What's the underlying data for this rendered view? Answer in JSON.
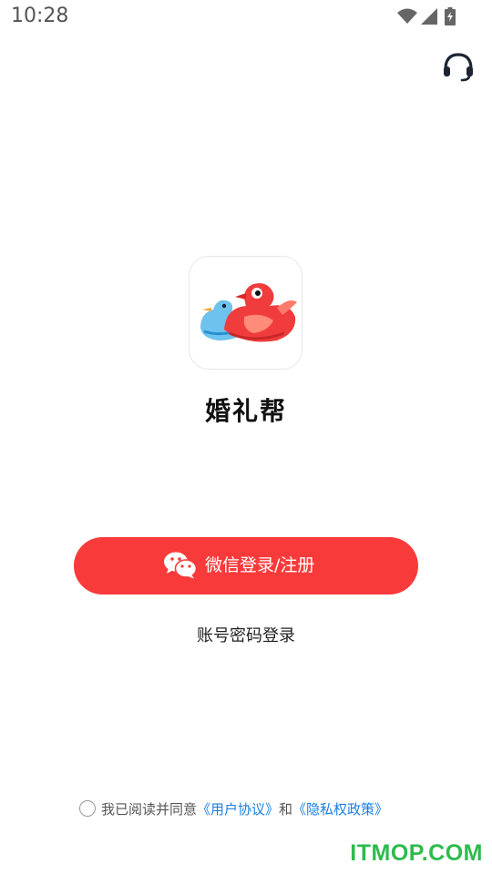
{
  "status_bar": {
    "time": "10:28",
    "icons": [
      "wifi-icon",
      "signal-icon",
      "battery-charging-icon"
    ]
  },
  "header": {
    "support_icon": "headset-icon"
  },
  "app": {
    "logo_icon": "mandarin-ducks-logo",
    "name": "婚礼帮"
  },
  "login": {
    "wechat_label": "微信登录/注册",
    "wechat_icon": "wechat-icon",
    "account_label": "账号密码登录",
    "accent_color": "#f93a3b"
  },
  "agreement": {
    "prefix": "我已阅读并同意",
    "user_agreement": "《用户协议》",
    "conjunction": "和",
    "privacy_policy": "《隐私权政策》",
    "link_color": "#1a7fe6"
  },
  "watermark": "ITMOP.COM"
}
